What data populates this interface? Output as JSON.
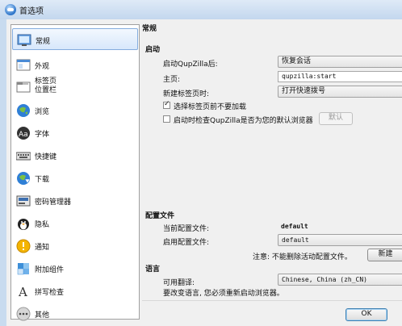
{
  "window": {
    "title": "首选项"
  },
  "sidebar": {
    "items": [
      {
        "label": "常规",
        "icon": "general-icon",
        "selected": true
      },
      {
        "label": "外观",
        "icon": "appearance-icon"
      },
      {
        "label": "标签页\n位置栏",
        "icon": "tabs-icon"
      },
      {
        "label": "浏览",
        "icon": "browsing-icon"
      },
      {
        "label": "字体",
        "icon": "fonts-icon"
      },
      {
        "label": "快捷键",
        "icon": "keyboard-icon"
      },
      {
        "label": "下载",
        "icon": "downloads-icon"
      },
      {
        "label": "密码管理器",
        "icon": "password-manager-icon"
      },
      {
        "label": "隐私",
        "icon": "privacy-icon"
      },
      {
        "label": "通知",
        "icon": "notifications-icon"
      },
      {
        "label": "附加组件",
        "icon": "extensions-icon"
      },
      {
        "label": "拼写检查",
        "icon": "spellcheck-icon"
      },
      {
        "label": "其他",
        "icon": "other-icon"
      }
    ]
  },
  "general": {
    "page_title": "常规",
    "startup": {
      "header": "启动",
      "after_launch_label": "启动QupZilla后:",
      "after_launch_value": "恢复会话",
      "homepage_label": "主页:",
      "homepage_value": "qupzilla:start",
      "new_tab_label": "新建标签页时:",
      "new_tab_value": "打开快速拨号",
      "no_load_tabs_label": "选择标签页前不要加载",
      "no_load_tabs_checked": true,
      "check_default_label": "启动时检查QupZilla是否为您的默认浏览器",
      "check_default_checked": false,
      "default_button": "默认"
    },
    "profiles": {
      "header": "配置文件",
      "current_label": "当前配置文件:",
      "current_value": "default",
      "startup_label": "启用配置文件:",
      "startup_value": "default",
      "note": "注意: 不能删除活动配置文件。",
      "new_button": "新建"
    },
    "language": {
      "header": "语言",
      "available_label": "可用翻译:",
      "available_value": "Chinese, China (zh_CN)",
      "restart_note": "要改变语言, 您必须重新启动浏览器。"
    },
    "ok_button": "OK"
  }
}
